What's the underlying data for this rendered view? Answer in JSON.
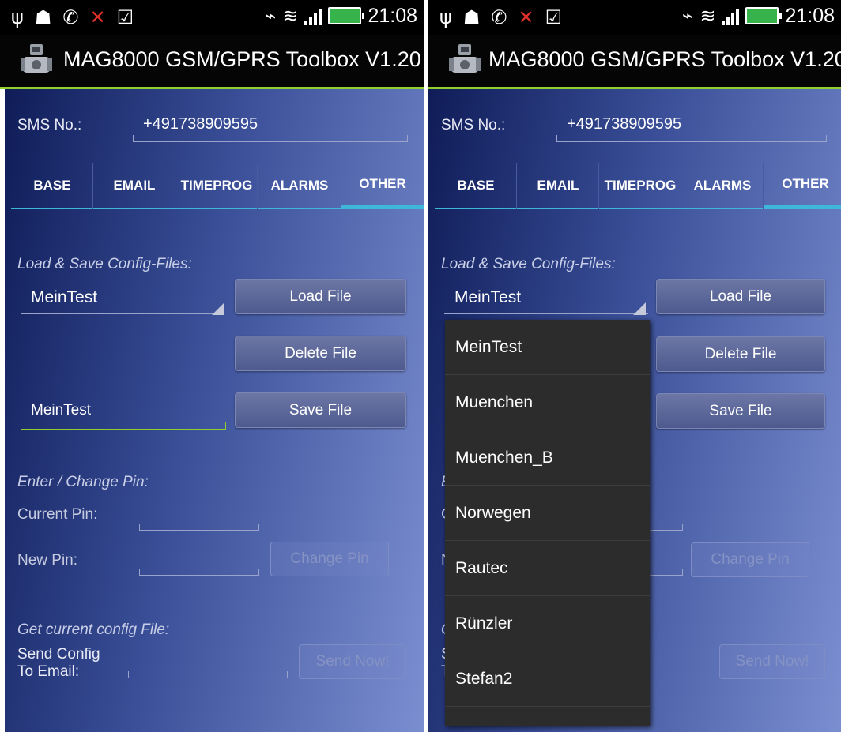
{
  "status_bar": {
    "time": "21:08",
    "left_icons": [
      "usb-icon",
      "android-debug-icon",
      "whatsapp-icon",
      "missed-call-icon",
      "shopping-bag-icon"
    ],
    "right_icons": [
      "vibrate-icon",
      "wifi-icon",
      "signal-icon",
      "battery-charging-icon"
    ]
  },
  "app": {
    "title": "MAG8000 GSM/GPRS Toolbox V1.20",
    "logo_icon": "flowmeter-icon"
  },
  "sms": {
    "label": "SMS No.:",
    "value": "+491738909595"
  },
  "tabs": [
    {
      "label": "BASE",
      "active": false
    },
    {
      "label": "EMAIL",
      "active": false
    },
    {
      "label": "TIMEPROG",
      "active": false
    },
    {
      "label": "ALARMS",
      "active": false
    },
    {
      "label": "OTHER",
      "active": true
    }
  ],
  "config_files": {
    "section_label": "Load & Save Config-Files:",
    "selected_file": "MeinTest",
    "load_button": "Load File",
    "delete_button": "Delete File",
    "save_name_value": "MeinTest",
    "save_button": "Save File"
  },
  "pin": {
    "section_label": "Enter / Change Pin:",
    "current_label": "Current Pin:",
    "new_label": "New Pin:",
    "change_button": "Change Pin"
  },
  "send_config": {
    "section_label": "Get current config File:",
    "label_line1": "Send Config",
    "label_line2": "To Email:",
    "send_button": "Send Now!"
  },
  "dropdown": {
    "options": [
      "MeinTest",
      "Muenchen",
      "Muenchen_B",
      "Norwegen",
      "Rautec",
      "Rünzler",
      "Stefan2"
    ]
  },
  "colors": {
    "accent_green": "#8ecf2e",
    "tab_indicator": "#3fb7d8",
    "background_start": "#0f1c58",
    "background_end": "#7b8ed0"
  }
}
